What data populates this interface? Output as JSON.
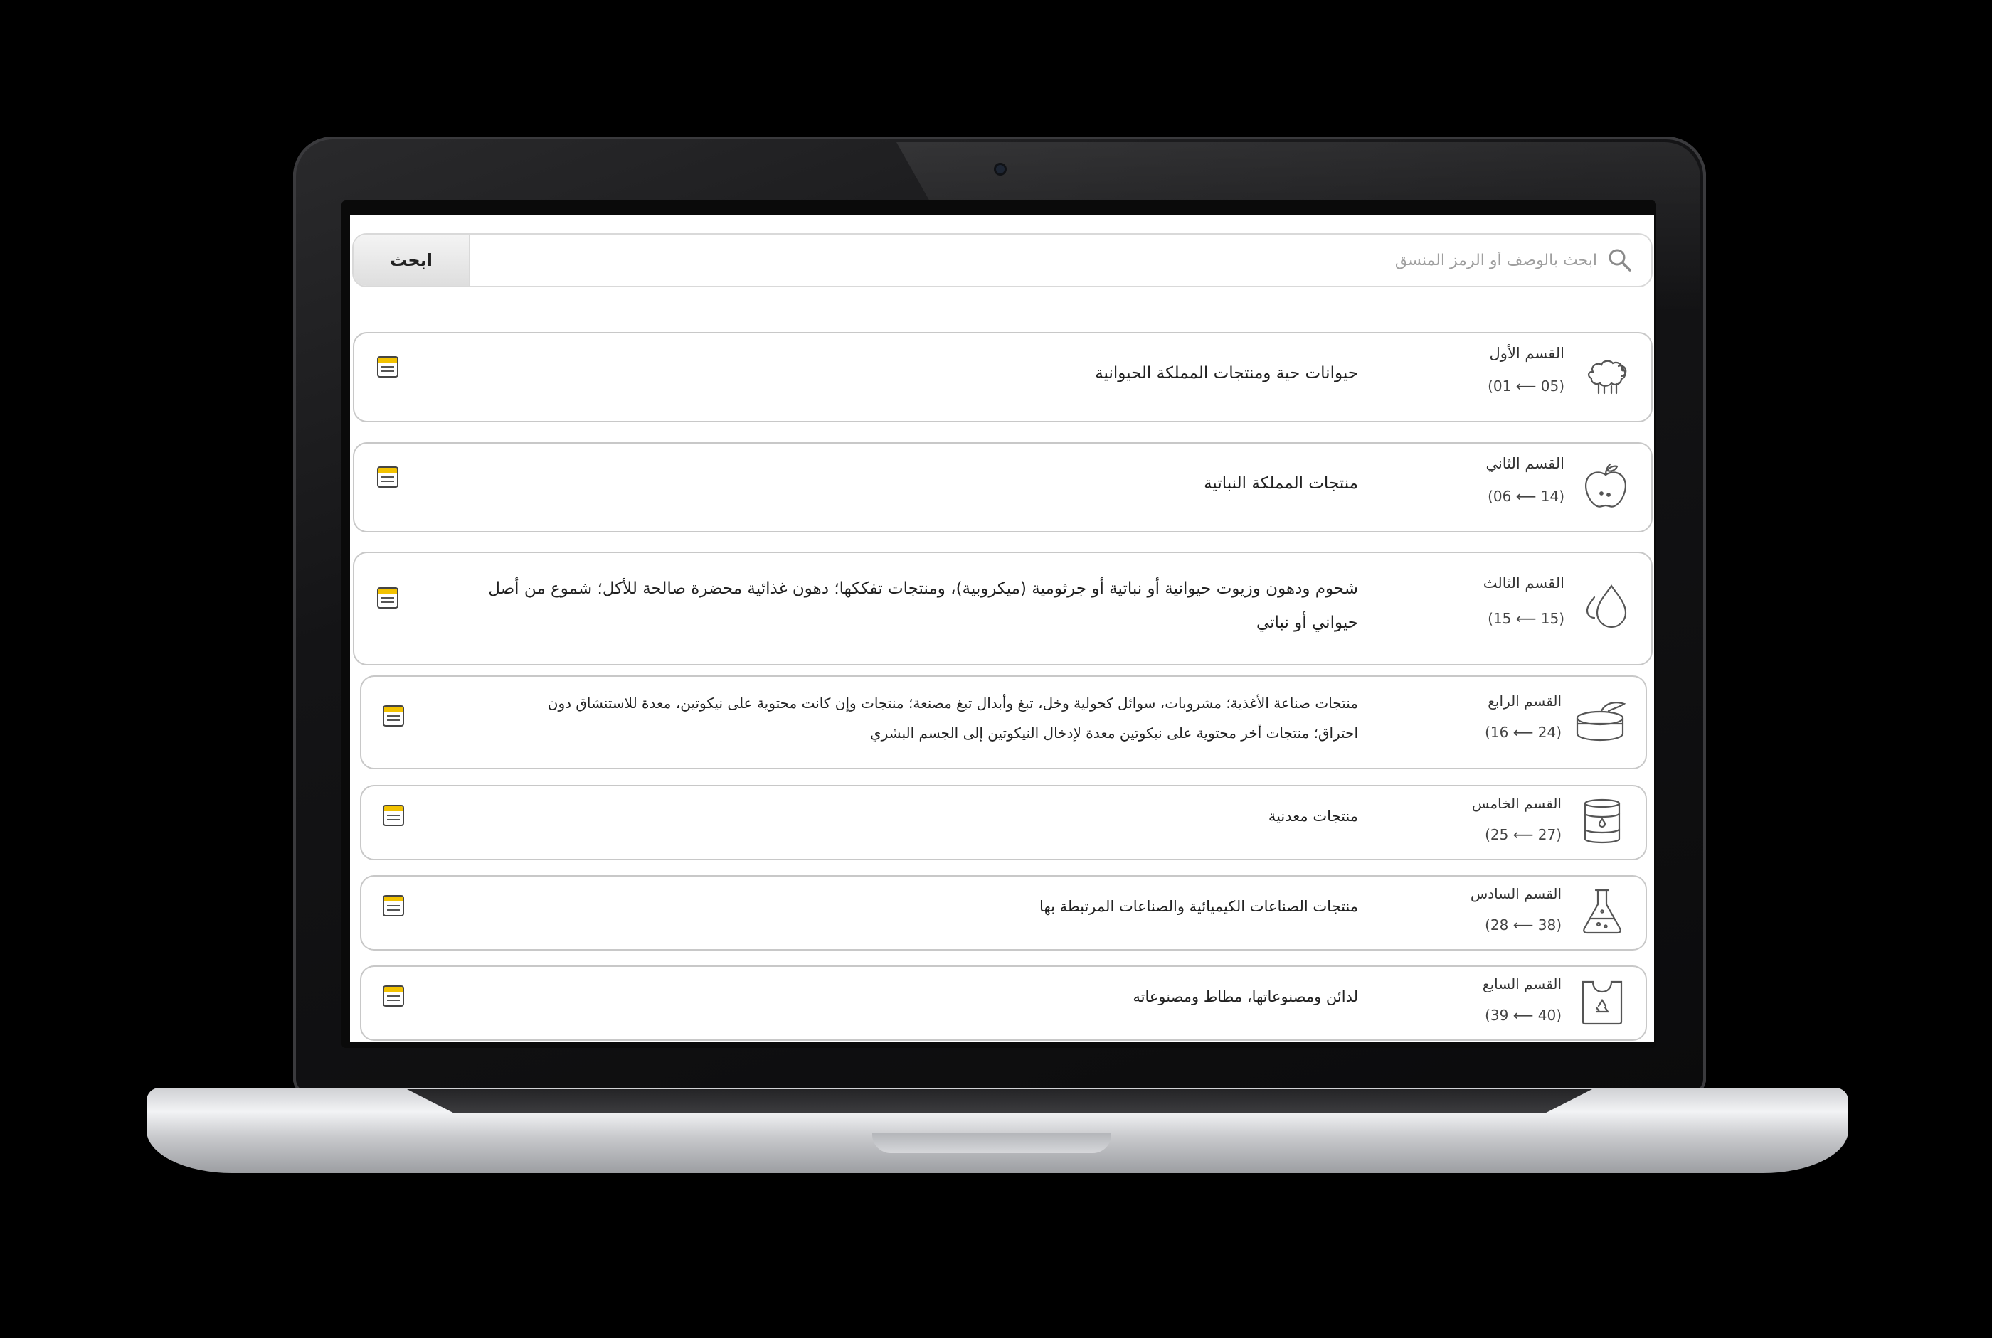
{
  "search": {
    "placeholder": "ابحث بالوصف أو الرمز المنسق",
    "button_label": "ابحث"
  },
  "sections": [
    {
      "title": "القسم الأول",
      "range": "(01 ⟵ 05)",
      "description": "حيوانات حية ومنتجات المملكة الحيوانية",
      "icon": "sheep-icon"
    },
    {
      "title": "القسم الثاني",
      "range": "(06 ⟵ 14)",
      "description": "منتجات المملكة النباتية",
      "icon": "apple-icon"
    },
    {
      "title": "القسم الثالث",
      "range": "(15 ⟵ 15)",
      "description": "شحوم ودهون وزيوت حيوانية أو نباتية أو جرثومية (ميكروبية)، ومنتجات تفككها؛ دهون غذائية محضرة صالحة للأكل؛ شموع من أصل حيواني أو نباتي",
      "icon": "droplets-icon"
    },
    {
      "title": "القسم الرابع",
      "range": "(16 ⟵ 24)",
      "description": "منتجات صناعة الأغذية؛ مشروبات، سوائل كحولية وخل، تبغ وأبدال تبغ مصنعة؛ منتجات وإن كانت محتوية على نيكوتين، معدة للاستنشاق دون احتراق؛ منتجات أخر محتوية على نيكوتين معدة لإدخال النيكوتين إلى الجسم البشري",
      "icon": "food-can-icon"
    },
    {
      "title": "القسم الخامس",
      "range": "(25 ⟵ 27)",
      "description": "منتجات معدنية",
      "icon": "oil-barrel-icon"
    },
    {
      "title": "القسم السادس",
      "range": "(28 ⟵ 38)",
      "description": "منتجات الصناعات الكيميائية والصناعات المرتبطة بها",
      "icon": "flask-icon"
    },
    {
      "title": "القسم السابع",
      "range": "(39 ⟵ 40)",
      "description": "لدائن ومصنوعاتها، مطاط ومصنوعاته",
      "icon": "plastic-bag-icon"
    }
  ],
  "colors": {
    "note_accent": "#f2c200",
    "border": "#c8c8c8"
  }
}
